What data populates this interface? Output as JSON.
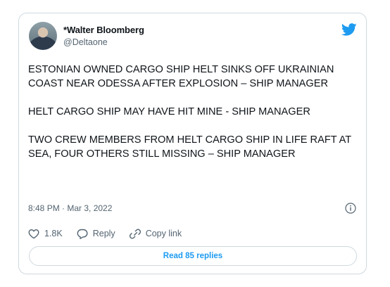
{
  "author": {
    "name": "*Walter Bloomberg",
    "handle": "@Deltaone"
  },
  "tweet": {
    "paragraphs": [
      "ESTONIAN OWNED CARGO SHIP HELT SINKS OFF UKRAINIAN COAST NEAR ODESSA AFTER EXPLOSION – SHIP MANAGER",
      "HELT CARGO SHIP MAY HAVE HIT MINE - SHIP MANAGER",
      "TWO CREW MEMBERS FROM HELT CARGO SHIP IN LIFE RAFT AT SEA, FOUR OTHERS STILL MISSING – SHIP MANAGER"
    ],
    "timestamp": "8:48 PM · Mar 3, 2022"
  },
  "actions": {
    "likes": "1.8K",
    "reply_label": "Reply",
    "copy_link_label": "Copy link"
  },
  "read_replies_label": "Read 85 replies",
  "icons": {
    "brand": "twitter-bird-icon",
    "info": "info-icon",
    "like": "heart-icon",
    "reply": "reply-bubble-icon",
    "copy": "link-icon"
  },
  "colors": {
    "accent": "#1d9bf0",
    "secondary_text": "#536471",
    "border": "#cfd9de"
  }
}
